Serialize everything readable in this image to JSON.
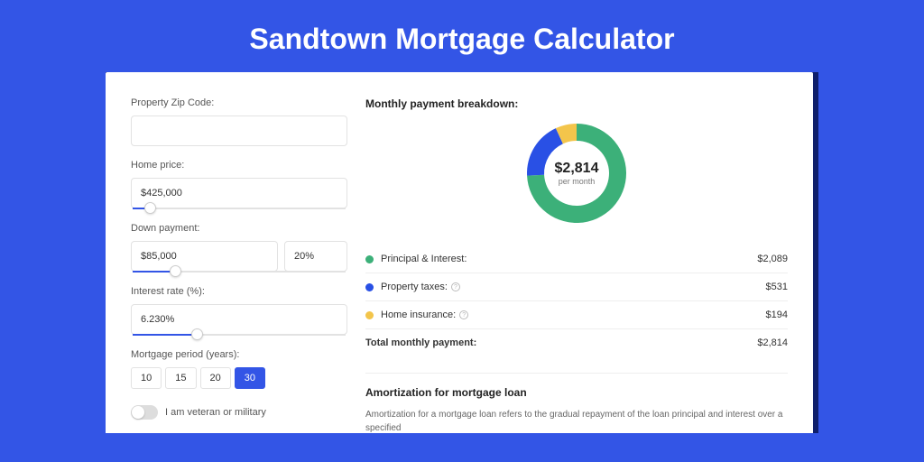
{
  "title": "Sandtown Mortgage Calculator",
  "form": {
    "zip_label": "Property Zip Code:",
    "zip_value": "",
    "home_price_label": "Home price:",
    "home_price_value": "$425,000",
    "home_price_slider_pct": 8,
    "down_label": "Down payment:",
    "down_amount": "$85,000",
    "down_pct": "20%",
    "down_slider_pct": 20,
    "rate_label": "Interest rate (%):",
    "rate_value": "6.230%",
    "rate_slider_pct": 30,
    "period_label": "Mortgage period (years):",
    "periods": [
      "10",
      "15",
      "20",
      "30"
    ],
    "period_active": "30",
    "veteran_label": "I am veteran or military"
  },
  "breakdown": {
    "title": "Monthly payment breakdown:",
    "center_amount": "$2,814",
    "center_sub": "per month",
    "rows": [
      {
        "color": "#3cb079",
        "label": "Principal & Interest:",
        "value": "$2,089",
        "info": false
      },
      {
        "color": "#2950e5",
        "label": "Property taxes:",
        "value": "$531",
        "info": true
      },
      {
        "color": "#f3c54b",
        "label": "Home insurance:",
        "value": "$194",
        "info": true
      }
    ],
    "total_label": "Total monthly payment:",
    "total_value": "$2,814"
  },
  "chart_data": {
    "type": "pie",
    "title": "Monthly payment breakdown",
    "series": [
      {
        "name": "Principal & Interest",
        "value": 2089,
        "color": "#3cb079"
      },
      {
        "name": "Property taxes",
        "value": 531,
        "color": "#2950e5"
      },
      {
        "name": "Home insurance",
        "value": 194,
        "color": "#f3c54b"
      }
    ],
    "total": 2814
  },
  "amortization": {
    "title": "Amortization for mortgage loan",
    "text": "Amortization for a mortgage loan refers to the gradual repayment of the loan principal and interest over a specified"
  }
}
